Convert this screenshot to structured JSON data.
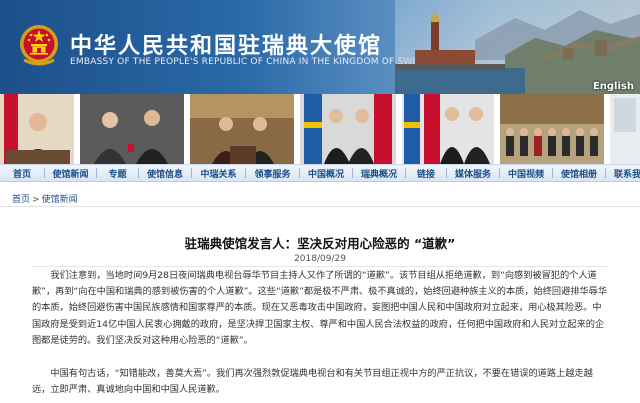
{
  "header": {
    "title_cn": "中华人民共和国驻瑞典大使馆",
    "title_en": "EMBASSY OF THE PEOPLE'S REPUBLIC OF CHINA IN THE KINGDOM OF SWEDEN",
    "lang_link": "English",
    "brand_color": "#1c4f8a"
  },
  "nav": {
    "items": [
      {
        "label": "首页"
      },
      {
        "label": "使馆新闻"
      },
      {
        "label": "专题"
      },
      {
        "label": "使馆信息"
      },
      {
        "label": "中瑞关系"
      },
      {
        "label": "领事服务"
      },
      {
        "label": "中国概况"
      },
      {
        "label": "瑞典概况"
      },
      {
        "label": "链接"
      },
      {
        "label": "媒体服务"
      },
      {
        "label": "中国视频"
      },
      {
        "label": "使馆相册"
      },
      {
        "label": "联系我们"
      }
    ]
  },
  "breadcrumb": {
    "items": [
      {
        "label": "首页"
      },
      {
        "label": "使馆新闻"
      }
    ],
    "separator": ">"
  },
  "article": {
    "title": "驻瑞典使馆发言人：坚决反对用心险恶的 “道歉”",
    "date": "2018/09/29",
    "paragraphs": [
      "我们注意到，当地时间9月28日夜间瑞典电视台辱华节目主持人又作了所谓的“道歉”。该节目组从拒绝道歉，到“向感到被冒犯的个人道歉”，再到“向在中国和瑞典的感到被伤害的个人道歉”。这些“道歉”都是极不严肃、极不真诚的，始终回避种族主义的本质，始终回避排华辱华的本质，始终回避伤害中国民族感情和国家尊严的本质。现在又恶毒攻击中国政府，妄图把中国人民和中国政府对立起来，用心极其险恶。中国政府是受到近14亿中国人民衷心拥戴的政府，是坚决捍卫国家主权、尊严和中国人民合法权益的政府，任何把中国政府和人民对立起来的企图都是徒劳的。我们坚决反对这种用心险恶的“道歉”。",
      "中国有句古话，“知错能改，善莫大焉”。我们再次强烈敦促瑞典电视台和有关节目组正视中方的严正抗议，不要在错误的道路上越走越远，立即严肃、真诚地向中国和中国人民道歉。"
    ]
  },
  "icons": {
    "emblem": "national-emblem-icon"
  }
}
